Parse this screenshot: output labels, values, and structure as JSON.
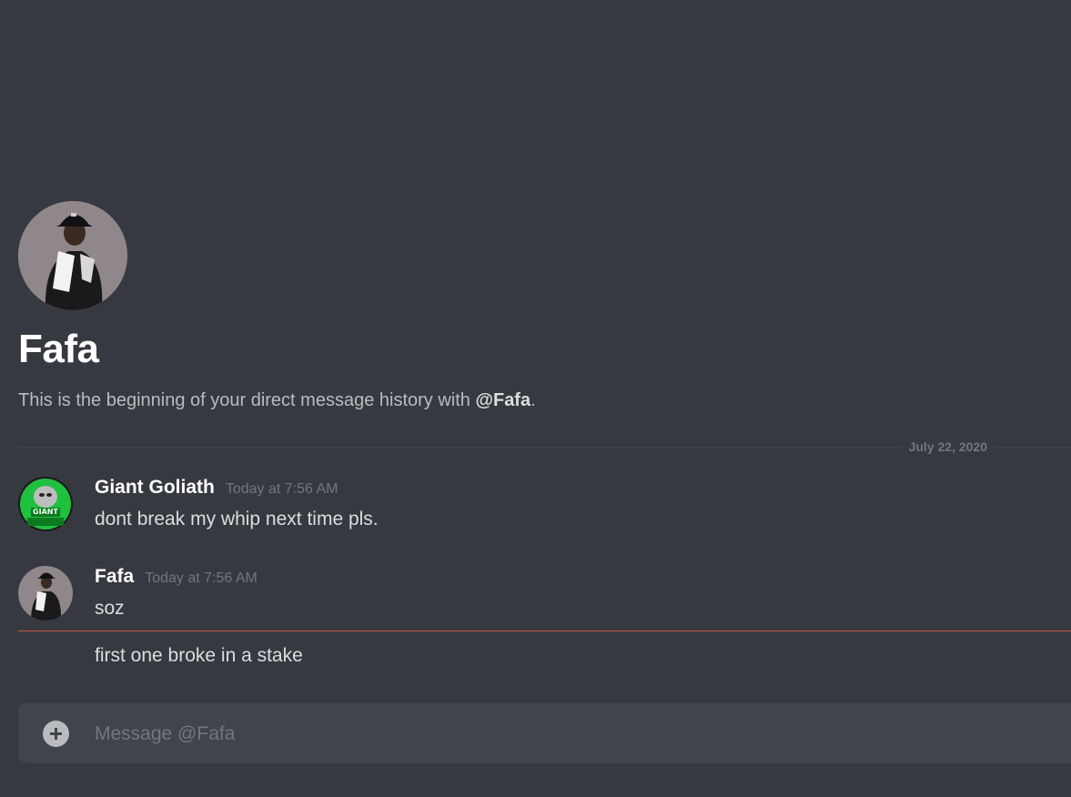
{
  "dm": {
    "recipient_name": "Fafa",
    "intro_text": "This is the beginning of your direct message history with ",
    "intro_mention": "@Fafa",
    "intro_end": "."
  },
  "divider": {
    "date": "July 22, 2020"
  },
  "messages": [
    {
      "author": "Giant Goliath",
      "timestamp": "Today at 7:56 AM",
      "lines": [
        "dont break my whip next time pls."
      ],
      "avatar_icon": "giant-goliath-avatar"
    },
    {
      "author": "Fafa",
      "timestamp": "Today at 7:56 AM",
      "lines": [
        "soz",
        "first one broke in a stake"
      ],
      "avatar_icon": "fafa-avatar"
    }
  ],
  "composer": {
    "placeholder": "Message @Fafa"
  },
  "colors": {
    "background": "#36393f",
    "composer": "#40444b",
    "new_messages_line": "#c2554a",
    "username": "#ffffff",
    "timestamp": "#72767d"
  }
}
